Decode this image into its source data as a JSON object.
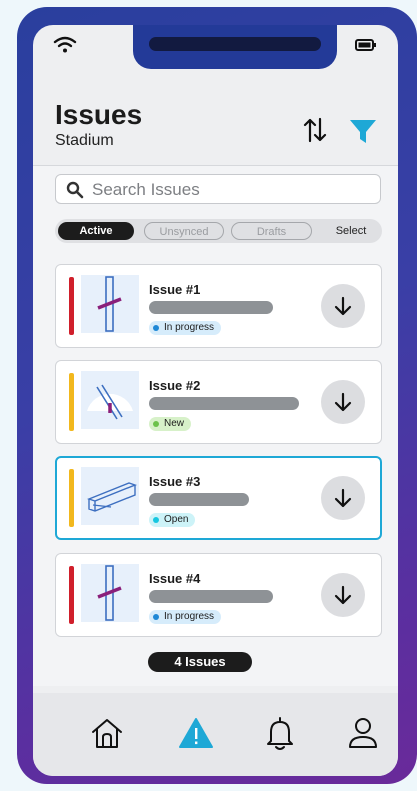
{
  "header": {
    "title": "Issues",
    "subtitle": "Stadium"
  },
  "search": {
    "placeholder": "Search Issues",
    "value": ""
  },
  "tabs": [
    {
      "label": "Active",
      "state": "active"
    },
    {
      "label": "Unsynced",
      "state": "inactive"
    },
    {
      "label": "Drafts",
      "state": "inactive"
    },
    {
      "label": "Select",
      "state": "action"
    }
  ],
  "issues": [
    {
      "title": "Issue #1",
      "status": "In progress",
      "stripe_color": "#d01f2b",
      "status_dot": "#1e88d6",
      "status_bg": "#d6ecfb",
      "selected": false,
      "thumb": "vertical-pipe-icon"
    },
    {
      "title": "Issue #2",
      "status": "New",
      "stripe_color": "#f2b81d",
      "status_dot": "#6cc24a",
      "status_bg": "#d7f1c9",
      "selected": false,
      "thumb": "gauge-icon"
    },
    {
      "title": "Issue #3",
      "status": "Open",
      "stripe_color": "#f2b81d",
      "status_dot": "#16c7e0",
      "status_bg": "#cdf3f8",
      "selected": true,
      "thumb": "beam-icon"
    },
    {
      "title": "Issue #4",
      "status": "In progress",
      "stripe_color": "#d01f2b",
      "status_dot": "#1e88d6",
      "status_bg": "#d6ecfb",
      "selected": false,
      "thumb": "vertical-pipe-icon"
    }
  ],
  "footer": {
    "count_label": "4 Issues"
  },
  "colors": {
    "accent": "#1ea8d6",
    "dark": "#1c1c1c",
    "frame": "#2a3f9e"
  },
  "nav": [
    {
      "icon": "home-icon",
      "active": false
    },
    {
      "icon": "warning-icon",
      "active": true
    },
    {
      "icon": "bell-icon",
      "active": false
    },
    {
      "icon": "user-icon",
      "active": false
    }
  ]
}
